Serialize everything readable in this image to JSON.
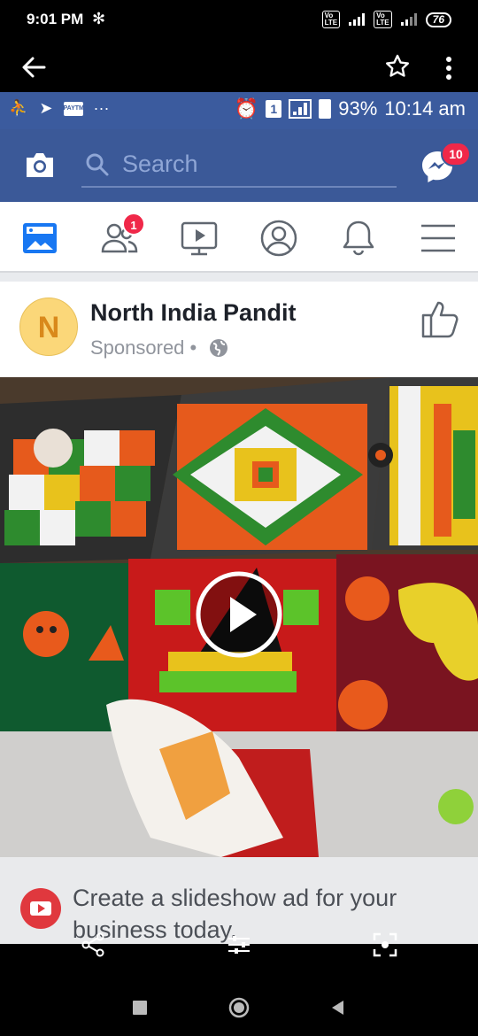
{
  "status_bar": {
    "time": "9:01 PM",
    "battery": "76"
  },
  "inner_status": {
    "battery_pct": "93%",
    "time": "10:14 am",
    "sim": "1",
    "paytm": "PAYTM",
    "dots": "···"
  },
  "fb": {
    "search_placeholder": "Search",
    "messenger_badge": "10",
    "friends_badge": "1"
  },
  "post": {
    "avatar_letter": "N",
    "page_name": "North India Pandit",
    "sponsored": "Sponsored",
    "separator": "•"
  },
  "cta": {
    "text": "Create a slideshow ad for your business today."
  },
  "colors": {
    "fb_blue": "#3b5998",
    "badge_red": "#f02849"
  }
}
